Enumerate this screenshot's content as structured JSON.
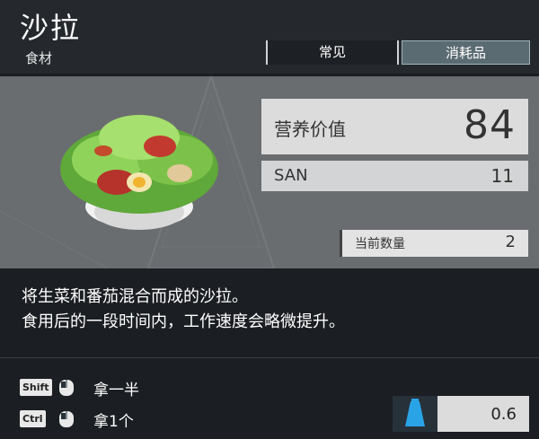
{
  "item": {
    "name": "沙拉",
    "category": "食材",
    "tags": [
      "常见",
      "消耗品"
    ]
  },
  "stats": {
    "nutrition_label": "营养价值",
    "nutrition_value": "84",
    "san_label": "SAN",
    "san_value": "11",
    "quantity_label": "当前数量",
    "quantity_value": "2"
  },
  "description": {
    "line1": "将生菜和番茄混合而成的沙拉。",
    "line2": "食用后的一段时间内，工作速度会略微提升。"
  },
  "controls": {
    "shift_key": "Shift",
    "shift_action": "拿一半",
    "ctrl_key": "Ctrl",
    "ctrl_action": "拿1个"
  },
  "weight": {
    "value": "0.6",
    "icon": "weight-icon",
    "icon_color": "#2aa3e6"
  },
  "colors": {
    "header_bg": "#25292e",
    "panel_bg": "#6a6d70",
    "accent_tag": "#5b6b72"
  }
}
